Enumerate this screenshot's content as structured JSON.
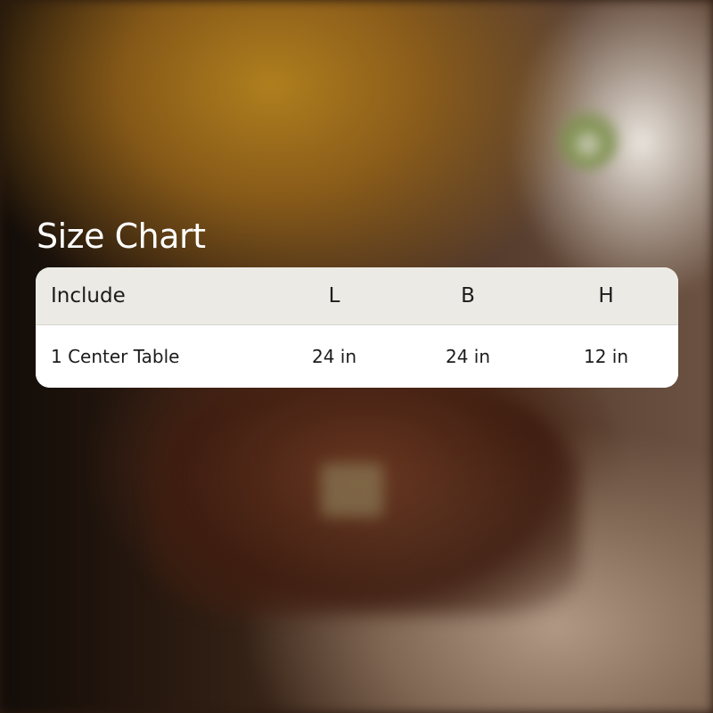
{
  "title": "Size Chart",
  "table": {
    "headers": {
      "include": "Include",
      "l": "L",
      "b": "B",
      "h": "H"
    },
    "rows": [
      {
        "include": "1 Center Table",
        "l": "24 in",
        "b": "24 in",
        "h": "12 in"
      }
    ]
  },
  "colors": {
    "header_bg": "#eceae5",
    "body_bg": "#ffffff",
    "text": "#1c1c1c",
    "title": "#ffffff"
  }
}
